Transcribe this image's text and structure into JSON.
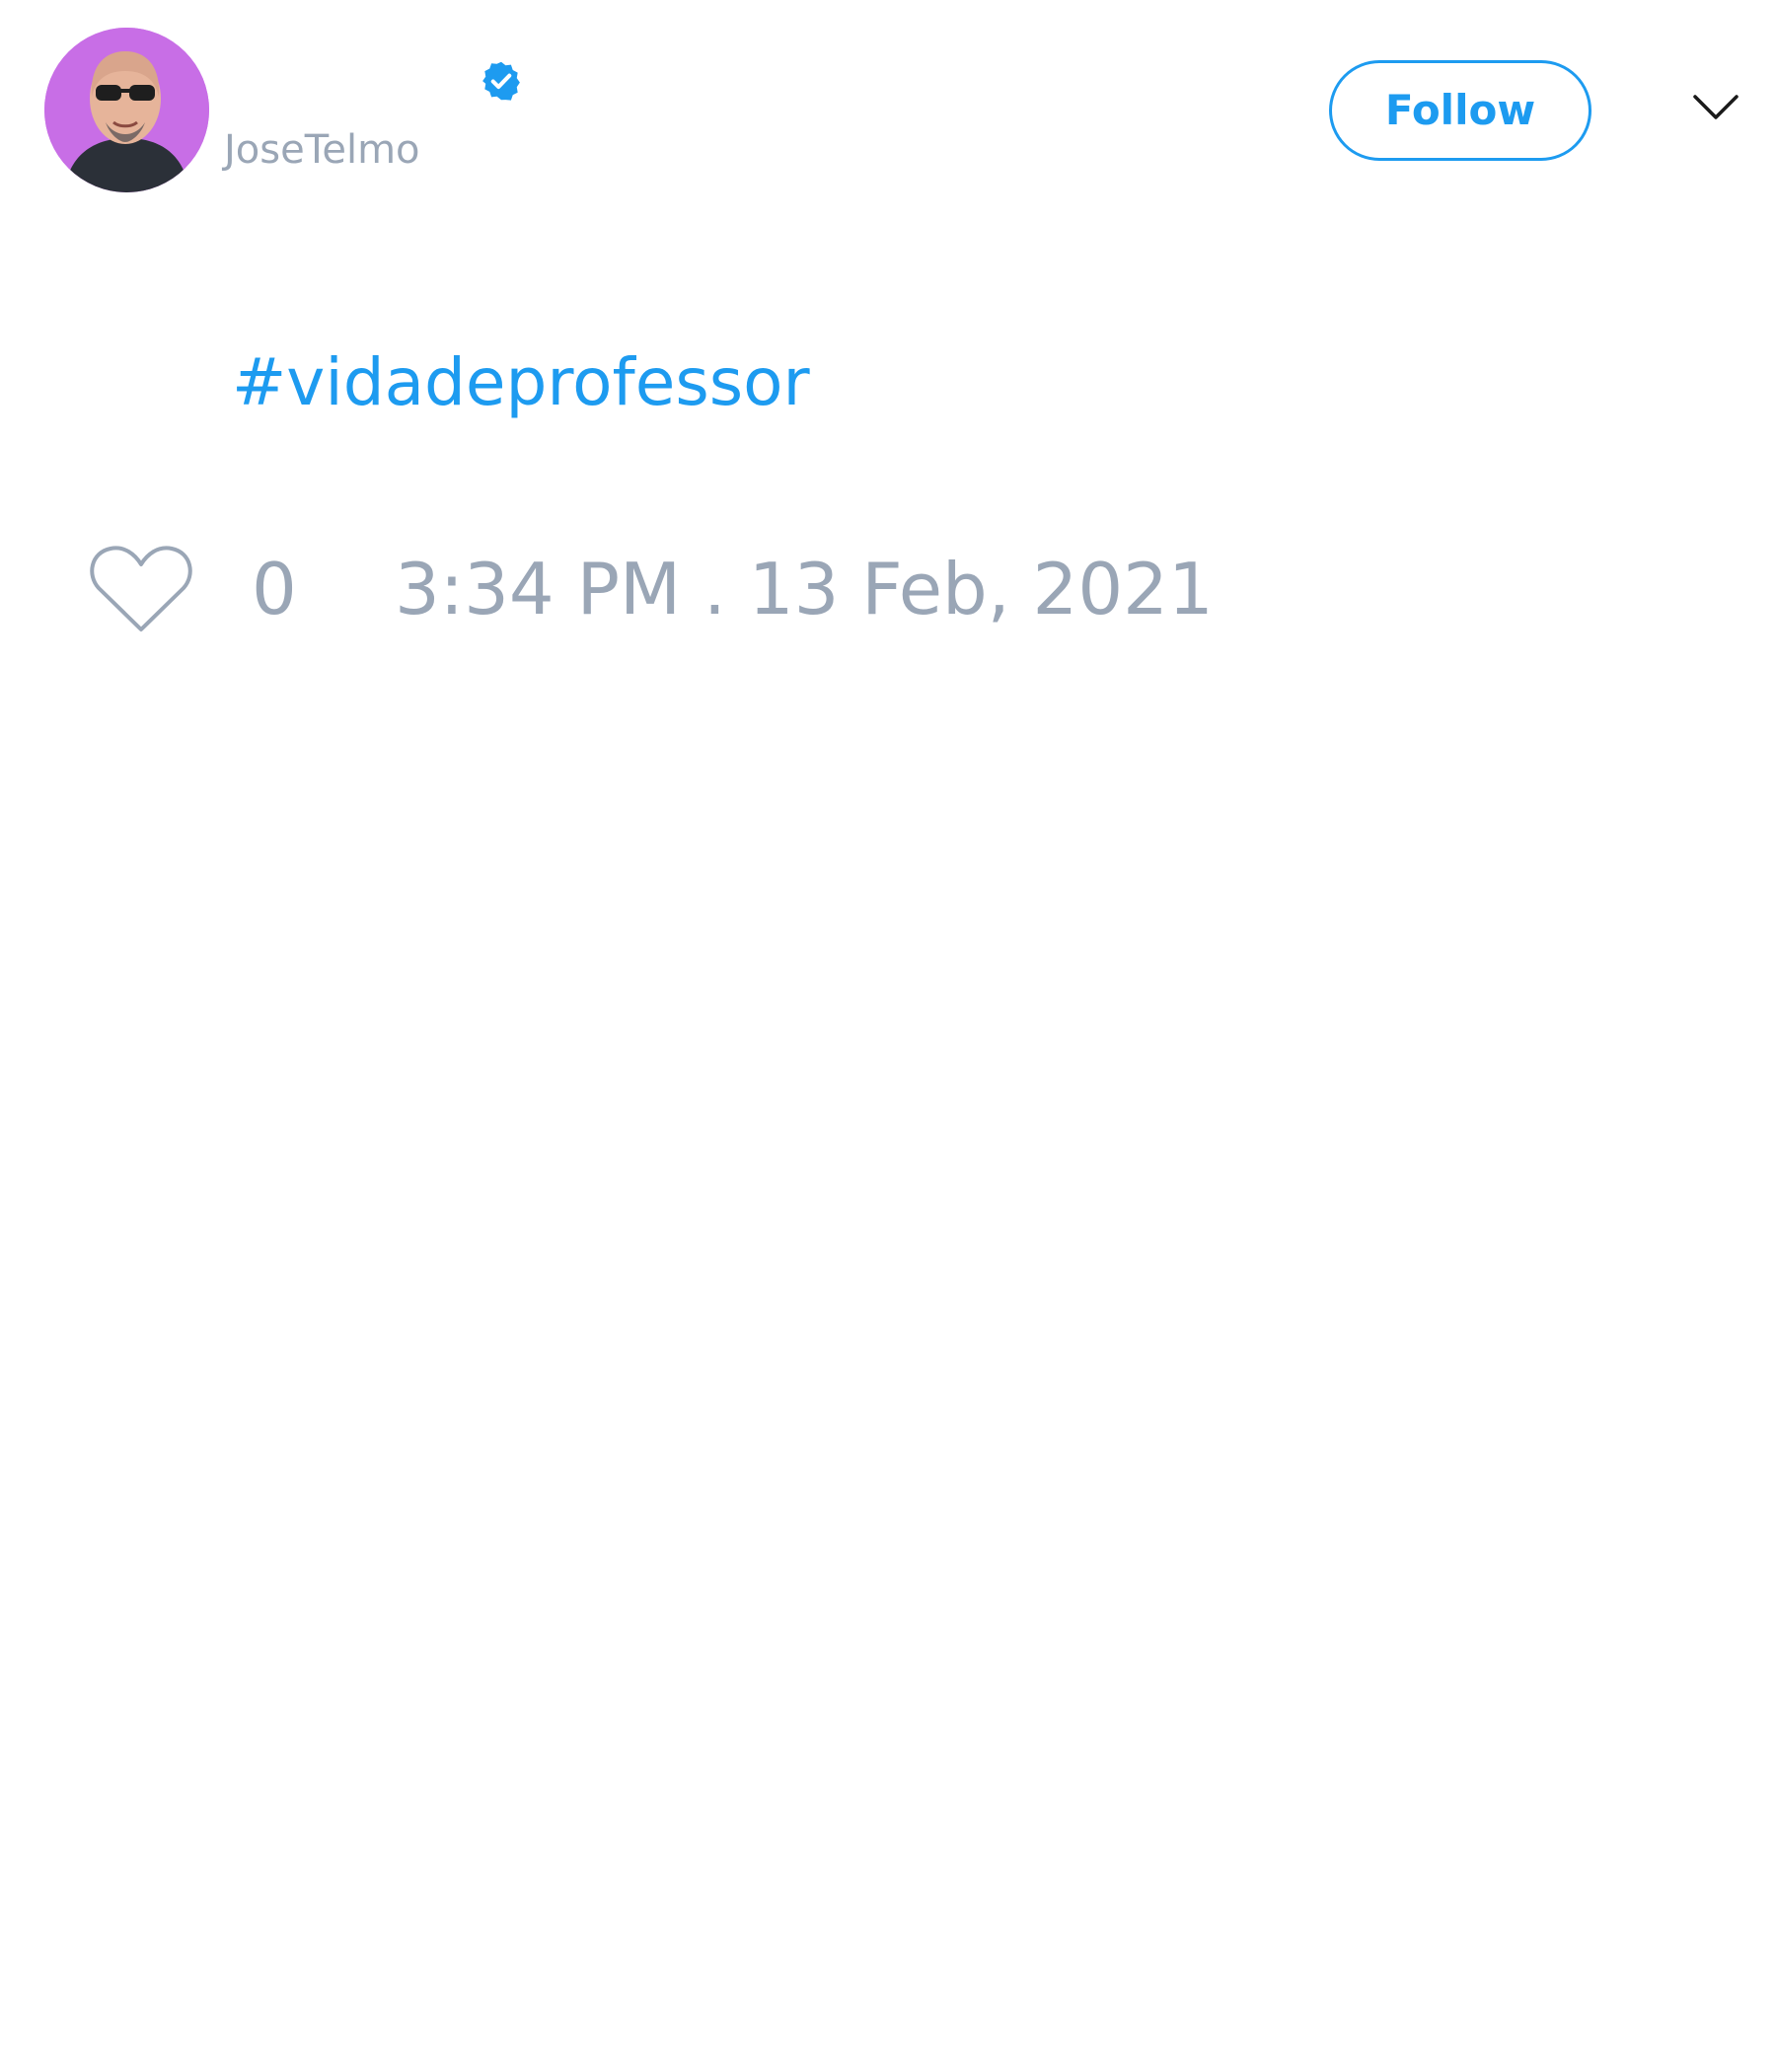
{
  "author": {
    "handle": "JoseTelmo",
    "verified": true
  },
  "actions": {
    "follow_label": "Follow"
  },
  "tweet": {
    "text": "#vidadeprofessor"
  },
  "engagement": {
    "likes": "0",
    "timestamp": "3:34 PM . 13 Feb, 2021"
  },
  "icons": {
    "verified": "verified-badge-icon",
    "menu": "chevron-down-icon",
    "like": "heart-icon"
  },
  "colors": {
    "accent": "#1d9bf0",
    "muted": "#9aa6b6",
    "avatar_bg": "#c86ee6"
  }
}
